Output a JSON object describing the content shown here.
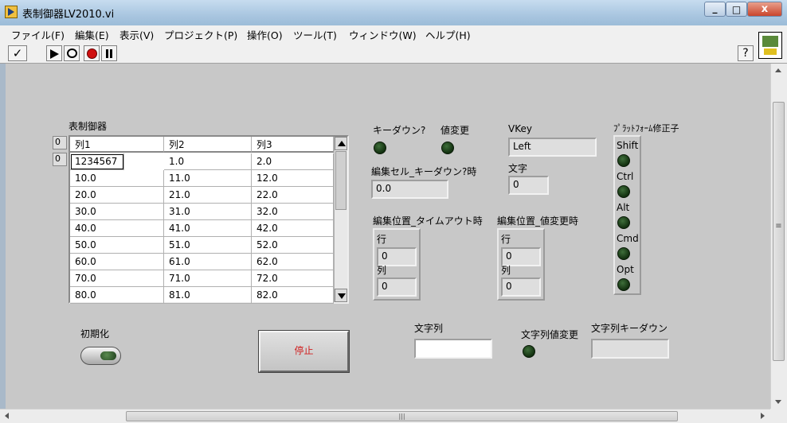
{
  "window": {
    "title": "表制御器LV2010.vi",
    "minimize": "_",
    "maximize": "□",
    "close": "x"
  },
  "menu": [
    "ファイル(F)",
    "編集(E)",
    "表示(V)",
    "プロジェクト(P)",
    "操作(O)",
    "ツール(T)",
    "ウィンドウ(W)",
    "ヘルプ(H)"
  ],
  "toolbar": {
    "check": "✓",
    "help": "?"
  },
  "table": {
    "label": "表制御器",
    "row_index": "0",
    "col_index": "0",
    "headers": [
      "列1",
      "列2",
      "列3"
    ],
    "rows": [
      [
        "1234567",
        "1.0",
        "2.0"
      ],
      [
        "10.0",
        "11.0",
        "12.0"
      ],
      [
        "20.0",
        "21.0",
        "22.0"
      ],
      [
        "30.0",
        "31.0",
        "32.0"
      ],
      [
        "40.0",
        "41.0",
        "42.0"
      ],
      [
        "50.0",
        "51.0",
        "52.0"
      ],
      [
        "60.0",
        "61.0",
        "62.0"
      ],
      [
        "70.0",
        "71.0",
        "72.0"
      ],
      [
        "80.0",
        "81.0",
        "82.0"
      ]
    ]
  },
  "keydown_label": "キーダウン?",
  "value_change_label": "値変更",
  "vkey": {
    "label": "VKey",
    "value": "Left"
  },
  "char": {
    "label": "文字",
    "value": "0"
  },
  "edit_cell_keydown": {
    "label": "編集セル_キーダウン?時",
    "value": "0.0"
  },
  "edit_pos_timeout": {
    "label": "編集位置_タイムアウト時",
    "row_label": "行",
    "row": "0",
    "col_label": "列",
    "col": "0"
  },
  "edit_pos_value_change": {
    "label": "編集位置_値変更時",
    "row_label": "行",
    "row": "0",
    "col_label": "列",
    "col": "0"
  },
  "platform": {
    "label": "ﾌﾟﾗｯﾄﾌｫｰﾑ修正子",
    "keys": [
      "Shift",
      "Ctrl",
      "Alt",
      "Cmd",
      "Opt"
    ]
  },
  "init": {
    "label": "初期化"
  },
  "stop": {
    "label": "停止"
  },
  "string": {
    "label": "文字列",
    "value": ""
  },
  "string_value_change": {
    "label": "文字列値変更"
  },
  "string_keydown": {
    "label": "文字列キーダウン",
    "value": ""
  },
  "scroll": {
    "grip": "≡",
    "hgrip": "|||"
  },
  "colors": {
    "led_off": "#1f3f1c",
    "stop_text": "#d02020",
    "panel": "#c8c8c8"
  }
}
